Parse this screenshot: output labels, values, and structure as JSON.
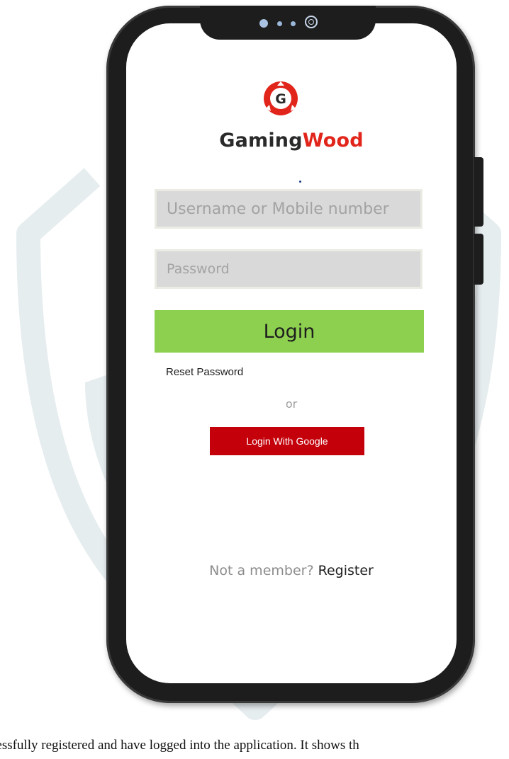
{
  "app": {
    "brand_part1": "Gaming",
    "brand_part2": "Wood",
    "logo_letter": "G"
  },
  "login": {
    "username_placeholder": "Username or Mobile number",
    "password_placeholder": "Password",
    "login_label": "Login",
    "reset_label": "Reset Password",
    "or_label": "or",
    "google_label": "Login With Google",
    "member_prompt": "Not a member?",
    "register_label": "Register"
  },
  "caption": "cessfully registered and have logged into the application. It shows th",
  "colors": {
    "brand_red": "#e2251b",
    "login_green": "#8dd050",
    "google_red": "#c4000a",
    "field_gray": "#d9d9d9",
    "watermark": "#e8eef0"
  },
  "icons": {
    "logo": "gamingwood-logo-icon",
    "notch": "camera-icon"
  }
}
